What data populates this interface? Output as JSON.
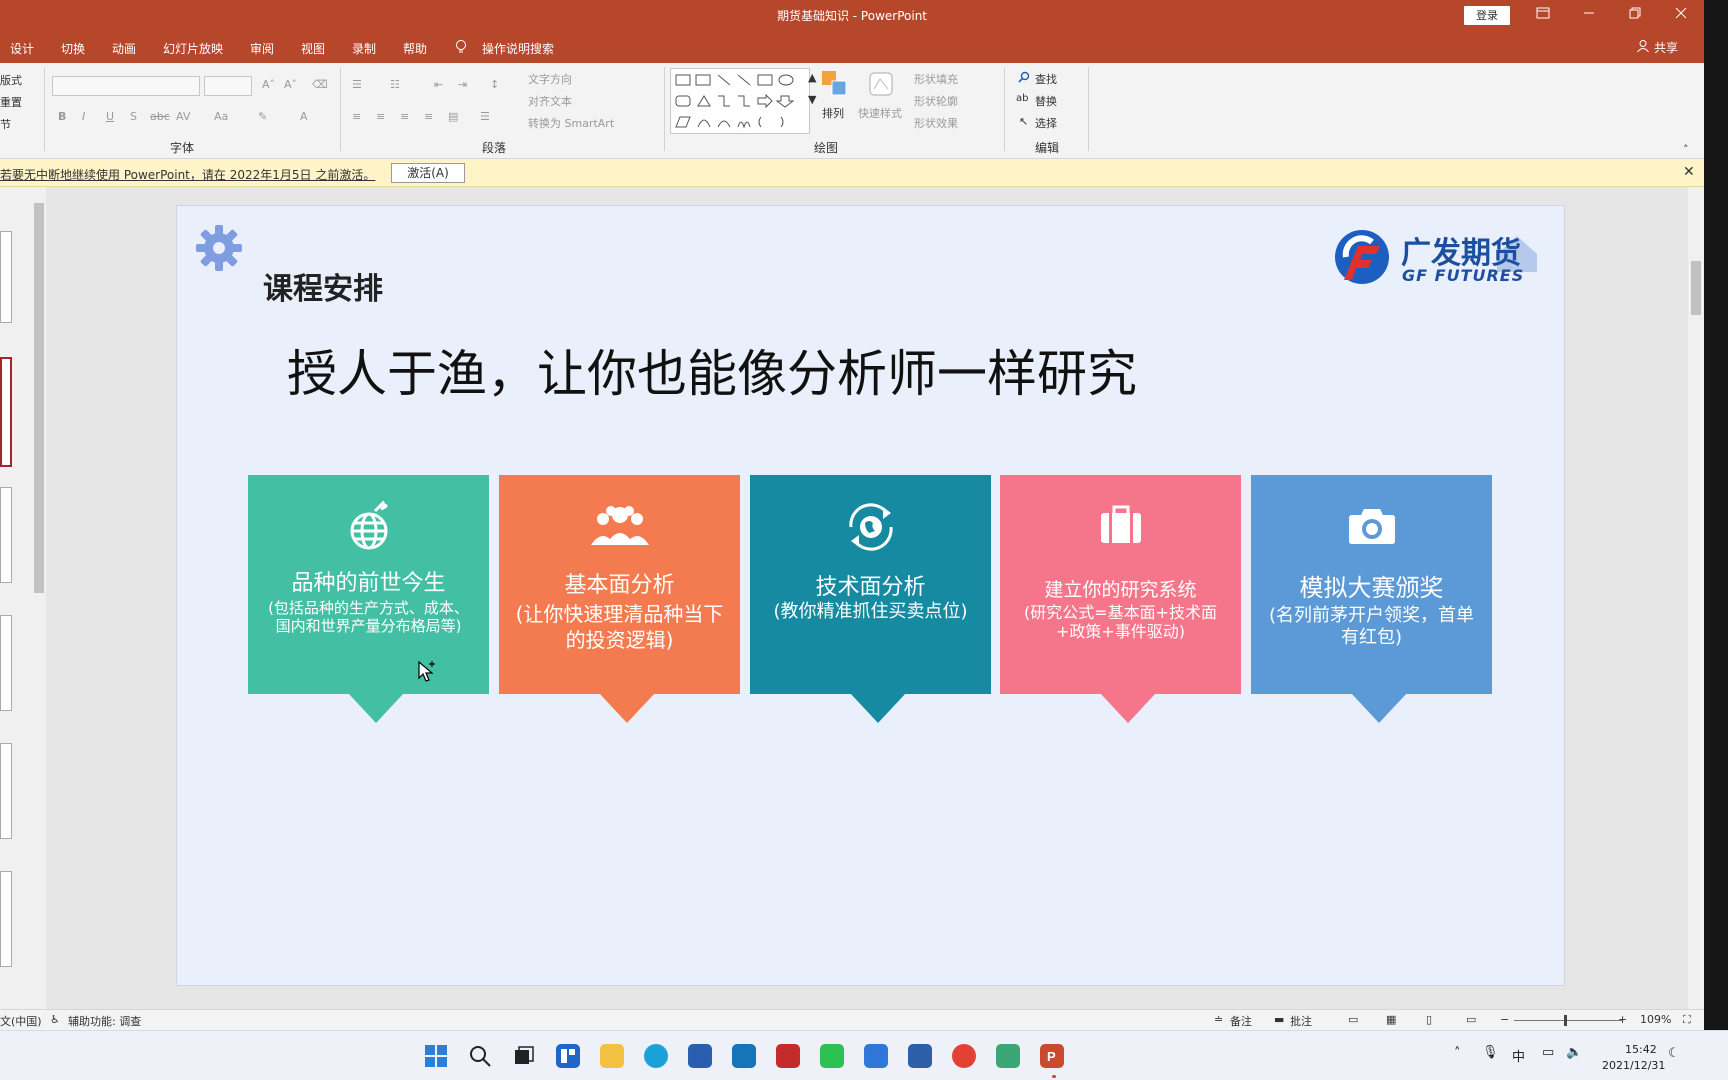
{
  "titlebar": {
    "title": "期货基础知识  -  PowerPoint",
    "login": "登录",
    "ribbon_display_icon": "ribbon-display-icon",
    "minimize_icon": "minimize-icon",
    "restore_icon": "restore-icon",
    "close_icon": "close-icon"
  },
  "tabs": [
    "设计",
    "切换",
    "动画",
    "幻灯片放映",
    "审阅",
    "视图",
    "录制",
    "帮助"
  ],
  "tell_me": "操作说明搜索",
  "share": "共享",
  "ribbon": {
    "clipboard_items": [
      "版式",
      "重置",
      "节"
    ],
    "font_group": "字体",
    "paragraph_group": "段落",
    "paragraph_text_items": [
      "文字方向",
      "对齐文本",
      "转换为 SmartArt"
    ],
    "drawing_group": "绘图",
    "arrange": "排列",
    "quick_styles": "快速样式",
    "shape_fill": "形状填充",
    "shape_outline": "形状轮廓",
    "shape_effects": "形状效果",
    "editing_group": "编辑",
    "find": "查找",
    "replace": "替换",
    "select": "选择"
  },
  "message_bar": {
    "text": "若要无中断地继续使用 PowerPoint，请在 2022年1月5日 之前激活。",
    "activate": "激活(A)"
  },
  "slide": {
    "title": "课程安排",
    "headline": "授人于渔，让你也能像分析师一样研究",
    "logo_cn": "广发期货",
    "logo_en": "GF FUTURES",
    "cards": [
      {
        "title": "品种的前世今生",
        "subtitle": "(包括品种的生产方式、成本、国内和世界产量分布格局等)",
        "color": "#43bfa3",
        "icon": "globe-icon"
      },
      {
        "title": "基本面分析",
        "subtitle": "(让你快速理清品种当下的投资逻辑)",
        "color": "#f47b50",
        "icon": "people-icon"
      },
      {
        "title": "技术面分析",
        "subtitle": "(教你精准抓住买卖点位)",
        "color": "#168aa0",
        "icon": "refresh-globe-icon"
      },
      {
        "title": "建立你的研究系统",
        "subtitle": "(研究公式=基本面+技术面+政策+事件驱动)",
        "color": "#f5758a",
        "icon": "briefcase-icon"
      },
      {
        "title": "模拟大赛颁奖",
        "subtitle": "(名列前茅开户领奖，首单有红包)",
        "color": "#5b9ad6",
        "icon": "camera-icon"
      }
    ]
  },
  "statusbar": {
    "language": "文(中国)",
    "accessibility": "辅助功能: 调查",
    "notes": "备注",
    "comments": "批注",
    "zoom": "109%"
  },
  "taskbar": {
    "ime": "中",
    "time": "15:42",
    "date": "2021/12/31"
  }
}
